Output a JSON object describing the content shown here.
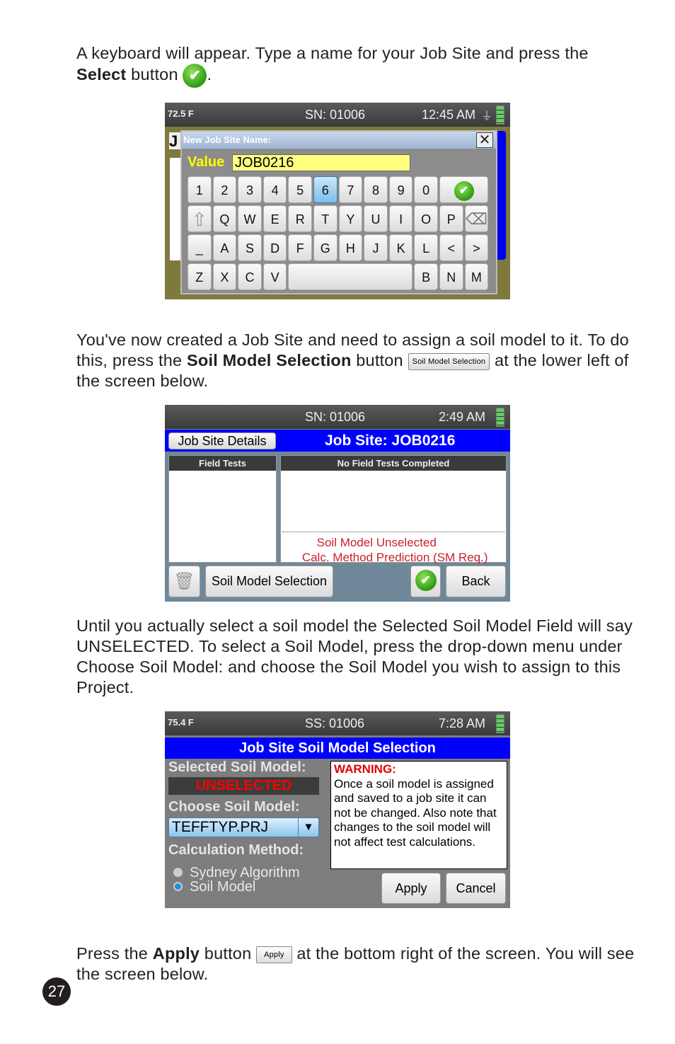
{
  "paragraphs": {
    "p1": {
      "text_a": "A keyboard will appear. Type a name for your Job Site and press the",
      "bold": "Select",
      "text_b": " button ",
      "end": "."
    },
    "p2": {
      "text_a": "You've now created a Job Site and need to assign a soil model to it. To do this, press the ",
      "bold": "Soil Model Selection",
      "text_b": " button ",
      "inline_button": "Soil Model Selection",
      "text_c": " at the lower left of the screen below."
    },
    "p3": {
      "text": "Until you actually select a soil model the Selected Soil Model Field will say UNSELECTED. To select a Soil Model, press the drop-down menu under Choose Soil Model: and choose the Soil Model you wish to assign to this Project."
    },
    "p4": {
      "text_a": "Press the ",
      "bold": "Apply",
      "text_b": " button ",
      "inline_button": "Apply",
      "text_c": " at the bottom right of the screen. You will see the screen below."
    }
  },
  "screen1": {
    "temp": "72.5 F",
    "sn": "SN: 01006",
    "time": "12:45 AM",
    "bg_letter": "J",
    "dialog_title": "New Job Site Name:",
    "value_label": "Value",
    "value": "JOB0216",
    "highlighted_key": "6",
    "rows": [
      [
        "1",
        "2",
        "3",
        "4",
        "5",
        "6",
        "7",
        "8",
        "9",
        "0"
      ],
      [
        "Q",
        "W",
        "E",
        "R",
        "T",
        "Y",
        "U",
        "I",
        "O",
        "P"
      ],
      [
        "_",
        "A",
        "S",
        "D",
        "F",
        "G",
        "H",
        "J",
        "K",
        "L",
        "<",
        ">"
      ],
      [
        "Z",
        "X",
        "C",
        "V"
      ],
      [
        "B",
        "N",
        "M"
      ]
    ]
  },
  "screen2": {
    "sn": "SN: 01006",
    "time": "2:49 AM",
    "details_button": "Job Site Details",
    "title": "Job Site:  JOB0216",
    "field_tests_header": "Field Tests",
    "tests_header": "No Field Tests Completed",
    "soil_model_label": "Soil Model",
    "soil_model_value": "Unselected",
    "calc_label": "Calc. Method",
    "calc_value": "Prediction (SM Req.)",
    "soil_button": "Soil Model Selection",
    "back_button": "Back"
  },
  "screen3": {
    "temp": "75.4 F",
    "sn": "SS: 01006",
    "time": "7:28 AM",
    "title": "Job Site Soil Model Selection",
    "selected_label": "Selected Soil Model:",
    "selected_value": "UNSELECTED",
    "choose_label": "Choose Soil Model:",
    "dropdown_value": "TEFFTYP.PRJ",
    "calc_label": "Calculation Method:",
    "radio_1": "Sydney Algorithm",
    "radio_2": "Soil Model",
    "radio_selected": "Soil Model",
    "warning_title": "WARNING:",
    "warning_text": "Once a soil model is assigned and saved to a job site it can not be changed. Also note that changes to the soil model will not affect test calculations.",
    "apply_button": "Apply",
    "cancel_button": "Cancel"
  },
  "page_number": "27",
  "colors": {
    "blue_bar": "#0000ff",
    "warning_red": "#e00000",
    "unselected_red": "#c8202a",
    "key_highlight": "#7cbde9"
  }
}
